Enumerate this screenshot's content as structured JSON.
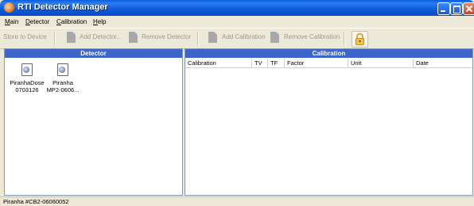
{
  "window": {
    "title": "RTI Detector Manager"
  },
  "menu": [
    {
      "label": "Main",
      "u": "M",
      "rest": "ain"
    },
    {
      "label": "Detector",
      "u": "D",
      "rest": "etector"
    },
    {
      "label": "Calibration",
      "u": "C",
      "rest": "alibration"
    },
    {
      "label": "Help",
      "u": "H",
      "rest": "elp"
    }
  ],
  "toolbar": {
    "store_to_device": "Store to Device",
    "add_detector": "Add Detector...",
    "remove_detector": "Remove Detector",
    "add_calibration": "Add Calibration",
    "remove_calibration": "Remove Calibration"
  },
  "detector_panel": {
    "header": "Detector",
    "items": [
      {
        "line1": "PiranhaDose",
        "line2": "0703126"
      },
      {
        "line1": "Piranha",
        "line2": "MP2-0606..."
      }
    ]
  },
  "calibration_panel": {
    "header": "Calibration",
    "columns": [
      "Calibration",
      "TV",
      "TF",
      "Factor",
      "Unit",
      "Date"
    ]
  },
  "status": {
    "text": "Piranha #CB2-06060052"
  },
  "colors": {
    "title_bar": "#0a5ddc",
    "panel_header": "#3c66c9",
    "chrome": "#ece9d8"
  }
}
